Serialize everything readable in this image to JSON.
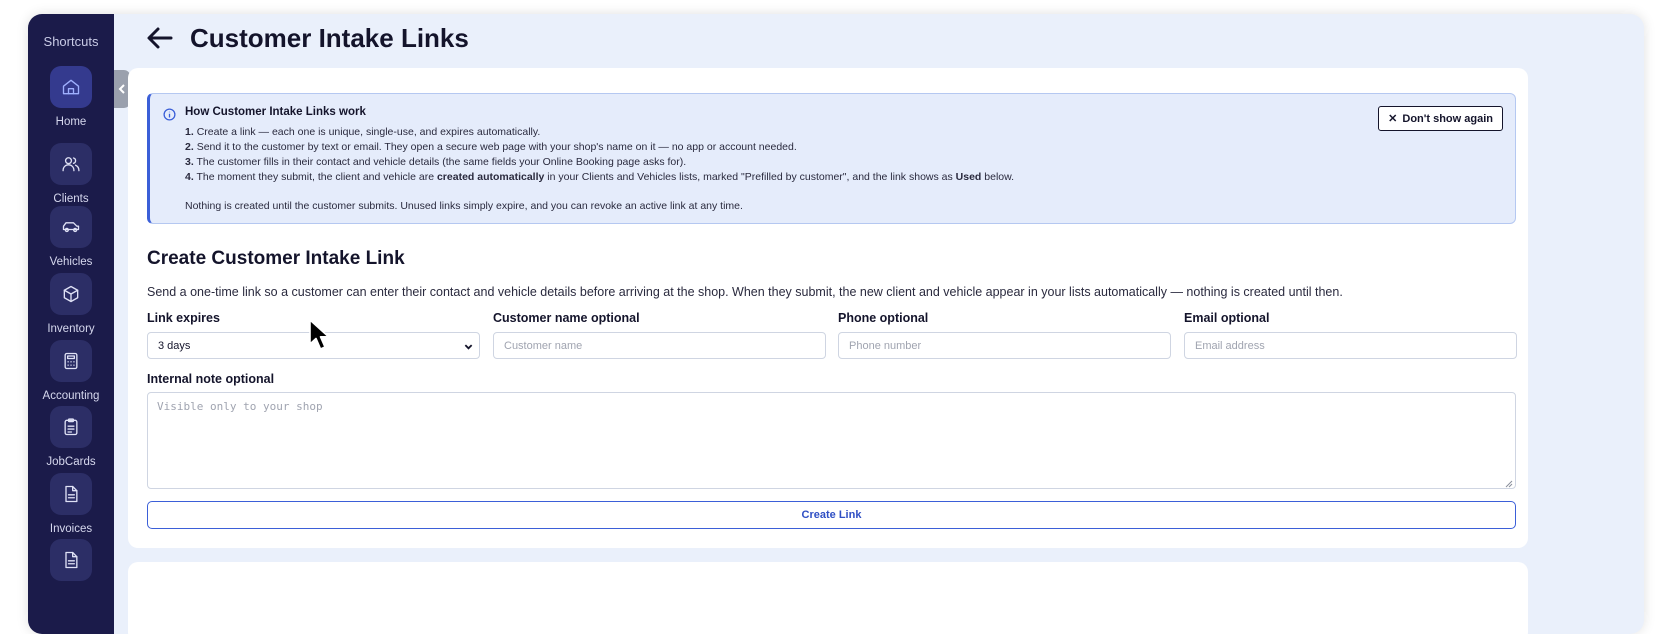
{
  "sidebar": {
    "shortcuts_label": "Shortcuts",
    "items": [
      {
        "label": "Home",
        "icon": "home-icon"
      },
      {
        "label": "Clients",
        "icon": "users-icon"
      },
      {
        "label": "Vehicles",
        "icon": "car-icon"
      },
      {
        "label": "Inventory",
        "icon": "box-icon"
      },
      {
        "label": "Accounting",
        "icon": "calculator-icon"
      },
      {
        "label": "JobCards",
        "icon": "clipboard-icon"
      },
      {
        "label": "Invoices",
        "icon": "invoice-icon"
      },
      {
        "label": "",
        "icon": "document-icon"
      }
    ],
    "active_item": "Home"
  },
  "header": {
    "title": "Customer Intake Links"
  },
  "info_banner": {
    "title": "How Customer Intake Links work",
    "steps": [
      {
        "num": "1.",
        "pre": "Create a link — each one is unique, single-use, and expires automatically.",
        "b1": "",
        "mid": "",
        "b2": "",
        "post": ""
      },
      {
        "num": "2.",
        "pre": "Send it to the customer by text or email. They open a secure web page with your shop's name on it — no app or account needed.",
        "b1": "",
        "mid": "",
        "b2": "",
        "post": ""
      },
      {
        "num": "3.",
        "pre": "The customer fills in their contact and vehicle details (the same fields your Online Booking page asks for).",
        "b1": "",
        "mid": "",
        "b2": "",
        "post": ""
      },
      {
        "num": "4.",
        "pre": "The moment they submit, the client and vehicle are ",
        "b1": "created automatically",
        "mid": " in your Clients and Vehicles lists, marked \"Prefilled by customer\", and the link shows as ",
        "b2": "Used",
        "post": " below."
      }
    ],
    "footer": "Nothing is created until the customer submits. Unused links simply expire, and you can revoke an active link at any time.",
    "dismiss_label": "Don't show again"
  },
  "form": {
    "title": "Create Customer Intake Link",
    "description": "Send a one-time link so a customer can enter their contact and vehicle details before arriving at the shop. When they submit, the new client and vehicle appear in your lists automatically — nothing is created until then.",
    "link_expires": {
      "label": "Link expires",
      "value": "3 days"
    },
    "customer_name": {
      "label": "Customer name optional",
      "placeholder": "Customer name"
    },
    "phone": {
      "label": "Phone optional",
      "placeholder": "Phone number"
    },
    "email": {
      "label": "Email optional",
      "placeholder": "Email address"
    },
    "note": {
      "label": "Internal note optional",
      "placeholder": "Visible only to your shop"
    },
    "submit_label": "Create Link"
  },
  "colors": {
    "sidebar_bg": "#1b1b4a",
    "accent": "#3b5fd8",
    "page_bg": "#eaf0fb"
  }
}
